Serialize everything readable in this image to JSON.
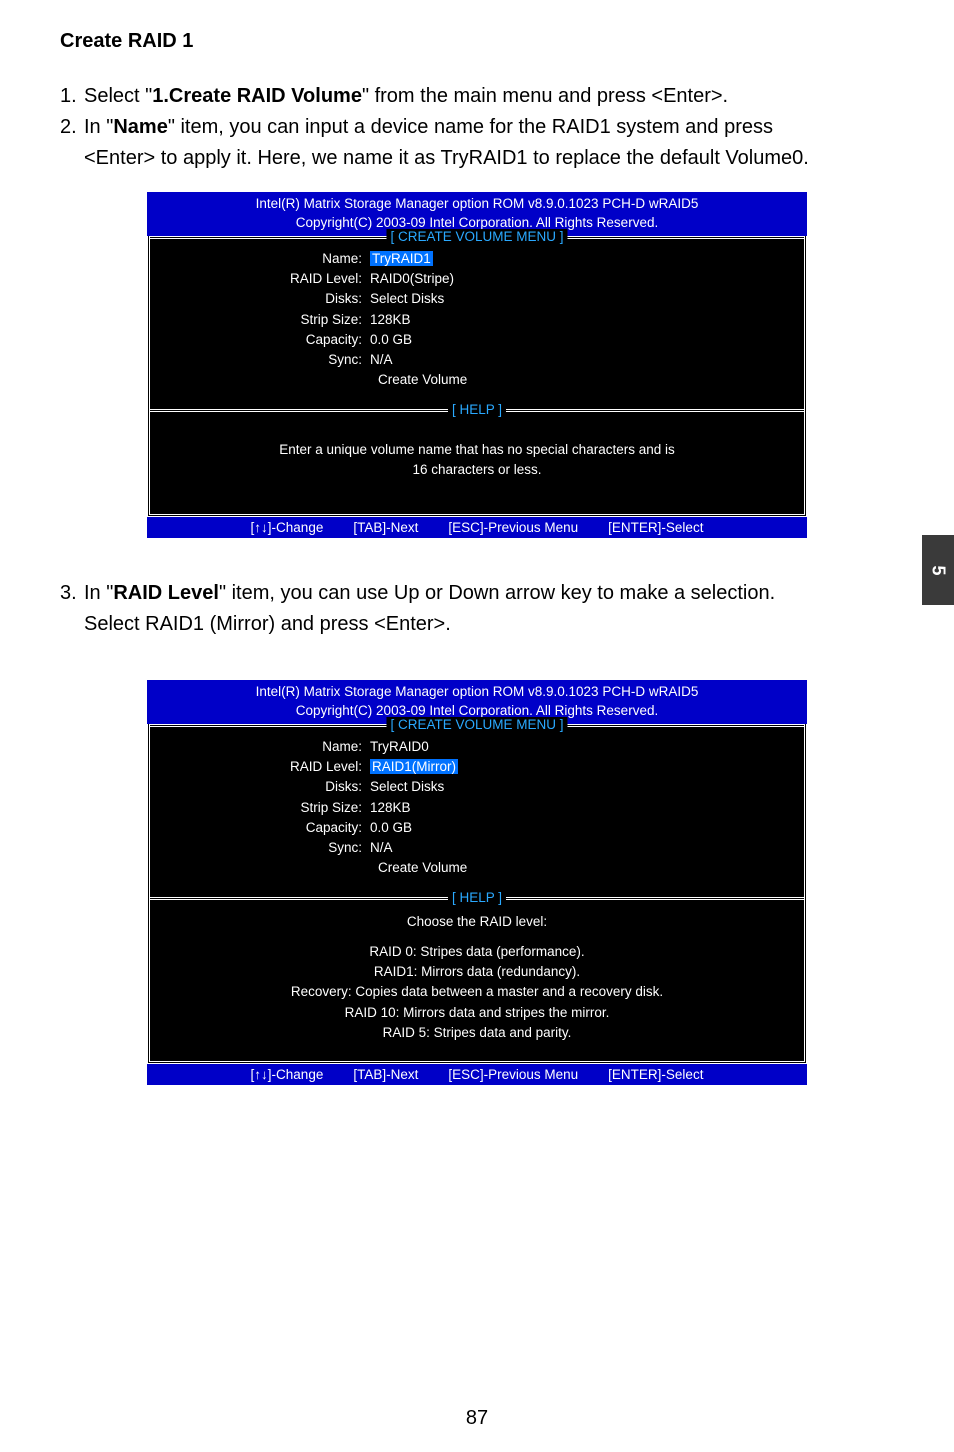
{
  "heading": "Create RAID 1",
  "step1": {
    "num": "1.",
    "pre": " Select \"",
    "bold": "1.Create RAID Volume",
    "post": "\" from the main menu and press <Enter>."
  },
  "step2": {
    "num": "2.",
    "pre": " In \"",
    "bold": "Name",
    "post": "\" item, you can input a device name for the RAID1 system and press",
    "cont": "<Enter> to apply it. Here, we name it as TryRAID1 to replace the default Volume0."
  },
  "bios1": {
    "header1": "Intel(R) Matrix Storage Manager option ROM v8.9.0.1023 PCH-D wRAID5",
    "header2": "Copyright(C) 2003-09 Intel Corporation.   All Rights Reserved.",
    "menu_title": "[ CREATE VOLUME MENU ]",
    "fields": {
      "name_label": "Name:",
      "name_value": "TryRAID1",
      "raid_label": "RAID Level:",
      "raid_value": "RAID0(Stripe)",
      "disks_label": "Disks:",
      "disks_value": "Select Disks",
      "strip_label": "Strip Size:",
      "strip_value": "128KB",
      "cap_label": "Capacity:",
      "cap_value": "0.0   GB",
      "sync_label": "Sync:",
      "sync_value": "N/A",
      "create": "Create Volume"
    },
    "help_title": "[ HELP ]",
    "help_line1": "Enter a unique volume name that has no special characters and is",
    "help_line2": "16 characters or less.",
    "footer": {
      "change": "[↑↓]-Change",
      "next": "[TAB]-Next",
      "prev": "[ESC]-Previous Menu",
      "select": "[ENTER]-Select"
    }
  },
  "step3": {
    "num": "3.",
    "pre": " In \"",
    "bold": "RAID Level",
    "post": "\" item, you can use Up or Down arrow key to make a selection.",
    "cont": "Select RAID1 (Mirror) and press <Enter>."
  },
  "bios2": {
    "header1": "Intel(R) Matrix Storage Manager option ROM v8.9.0.1023 PCH-D wRAID5",
    "header2": "Copyright(C) 2003-09 Intel Corporation.   All Rights Reserved.",
    "menu_title": "[ CREATE VOLUME MENU ]",
    "fields": {
      "name_label": "Name:",
      "name_value": "TryRAID0",
      "raid_label": "RAID Level:",
      "raid_value": "RAID1(Mirror)",
      "disks_label": "Disks:",
      "disks_value": "Select Disks",
      "strip_label": "Strip Size:",
      "strip_value": "128KB",
      "cap_label": "Capacity:",
      "cap_value": "0.0   GB",
      "sync_label": "Sync:",
      "sync_value": "N/A",
      "create": "Create Volume"
    },
    "help_title": "[ HELP ]",
    "help_line0": "Choose the RAID level:",
    "help_line1": "RAID 0: Stripes data (performance).",
    "help_line2": "RAID1: Mirrors data (redundancy).",
    "help_line3": "Recovery: Copies data between a master and a recovery disk.",
    "help_line4": "RAID 10: Mirrors data and stripes the mirror.",
    "help_line5": "RAID 5: Stripes data and parity.",
    "footer": {
      "change": "[↑↓]-Change",
      "next": "[TAB]-Next",
      "prev": "[ESC]-Previous Menu",
      "select": "[ENTER]-Select"
    }
  },
  "page_number": "87",
  "side_tab": "5"
}
